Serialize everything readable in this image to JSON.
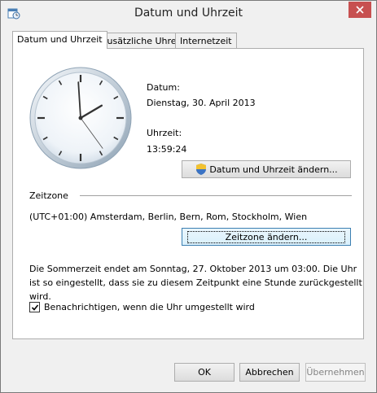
{
  "window": {
    "title": "Datum und Uhrzeit",
    "close_icon": "close-icon"
  },
  "tabs": [
    {
      "label": "Datum und Uhrzeit",
      "active": true
    },
    {
      "label": "Zusätzliche Uhren",
      "active": false
    },
    {
      "label": "Internetzeit",
      "active": false
    }
  ],
  "date": {
    "label": "Datum:",
    "value": "Dienstag, 30. April 2013"
  },
  "time": {
    "label": "Uhrzeit:",
    "value": "13:59:24"
  },
  "change_datetime_button": "Datum und Uhrzeit ändern...",
  "timezone": {
    "heading": "Zeitzone",
    "value": "(UTC+01:00) Amsterdam, Berlin, Bern, Rom, Stockholm, Wien",
    "change_button": "Zeitzone ändern..."
  },
  "dst_note": "Die Sommerzeit endet am Sonntag, 27. Oktober 2013 um 03:00. Die Uhr ist so eingestellt, dass sie zu diesem Zeitpunkt eine Stunde zurückgestellt wird.",
  "notify_checkbox": {
    "label": "Benachrichtigen, wenn die Uhr umgestellt wird",
    "checked": true
  },
  "footer": {
    "ok": "OK",
    "cancel": "Abbrechen",
    "apply": "Übernehmen"
  },
  "colors": {
    "accent": "#3c7fb1",
    "close": "#c75050"
  }
}
